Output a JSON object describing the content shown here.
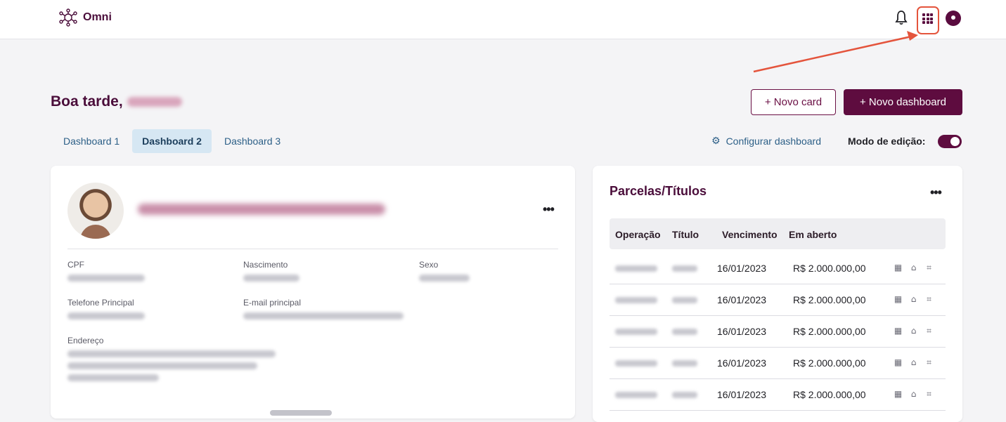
{
  "app": {
    "name": "Omni"
  },
  "header": {
    "greeting": "Boa tarde,",
    "new_card": "+ Novo card",
    "new_dashboard": "+ Novo dashboard"
  },
  "tabs": [
    {
      "label": "Dashboard 1"
    },
    {
      "label": "Dashboard 2",
      "active": true
    },
    {
      "label": "Dashboard 3"
    }
  ],
  "config_label": "Configurar dashboard",
  "edit_mode": {
    "label": "Modo de edição:",
    "on": true
  },
  "profile": {
    "fields": {
      "cpf": "CPF",
      "birth": "Nascimento",
      "sex": "Sexo",
      "phone": "Telefone Principal",
      "email": "E-mail principal",
      "address": "Endereço"
    }
  },
  "parcelas": {
    "title": "Parcelas/Títulos",
    "columns": [
      "Operação",
      "Título",
      "Vencimento",
      "Em aberto"
    ],
    "rows": [
      {
        "vencimento": "16/01/2023",
        "aberto": "R$ 2.000.000,00"
      },
      {
        "vencimento": "16/01/2023",
        "aberto": "R$ 2.000.000,00"
      },
      {
        "vencimento": "16/01/2023",
        "aberto": "R$ 2.000.000,00"
      },
      {
        "vencimento": "16/01/2023",
        "aberto": "R$ 2.000.000,00"
      },
      {
        "vencimento": "16/01/2023",
        "aberto": "R$ 2.000.000,00"
      }
    ]
  },
  "colors": {
    "brand": "#5e0c3f",
    "highlight": "#e4543c",
    "tab_active": "#d6e7f3"
  },
  "icons": [
    "network-logo-icon",
    "bell-icon",
    "apps-grid-icon",
    "user-icon",
    "gear-icon",
    "more-icon",
    "qr-code-icon",
    "bank-icon",
    "scan-icon"
  ]
}
